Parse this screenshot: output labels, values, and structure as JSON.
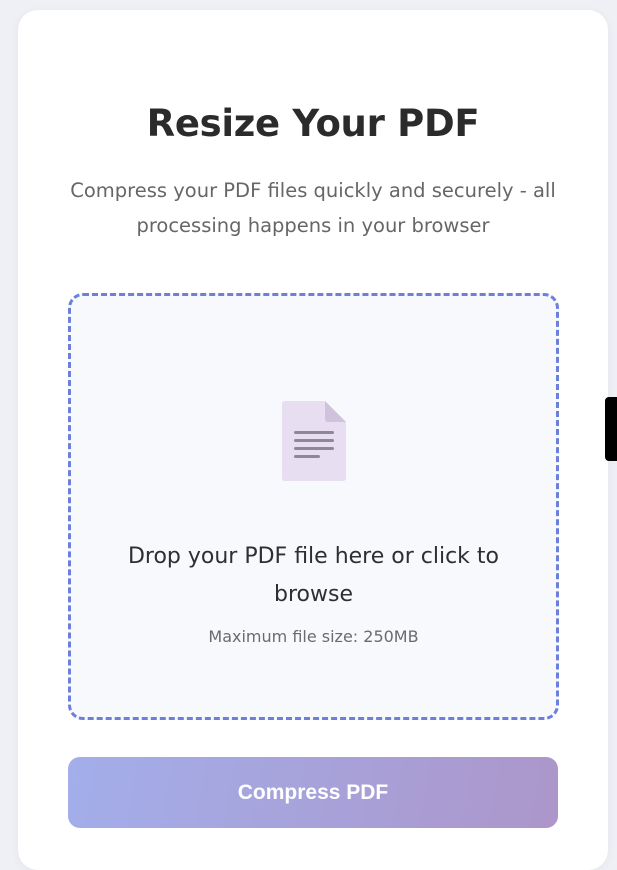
{
  "page": {
    "title": "Resize Your PDF",
    "subtitle": "Compress your PDF files quickly and securely - all processing happens in your browser"
  },
  "dropzone": {
    "icon": "document-icon",
    "prompt": "Drop your PDF file here or click to browse",
    "size_note": "Maximum file size: 250MB"
  },
  "actions": {
    "compress_label": "Compress PDF"
  },
  "colors": {
    "dropzone_border": "#6c7fdb",
    "button_gradient_start": "#a3aeea",
    "button_gradient_end": "#ac96ca",
    "title_text": "#2b2b2b"
  }
}
